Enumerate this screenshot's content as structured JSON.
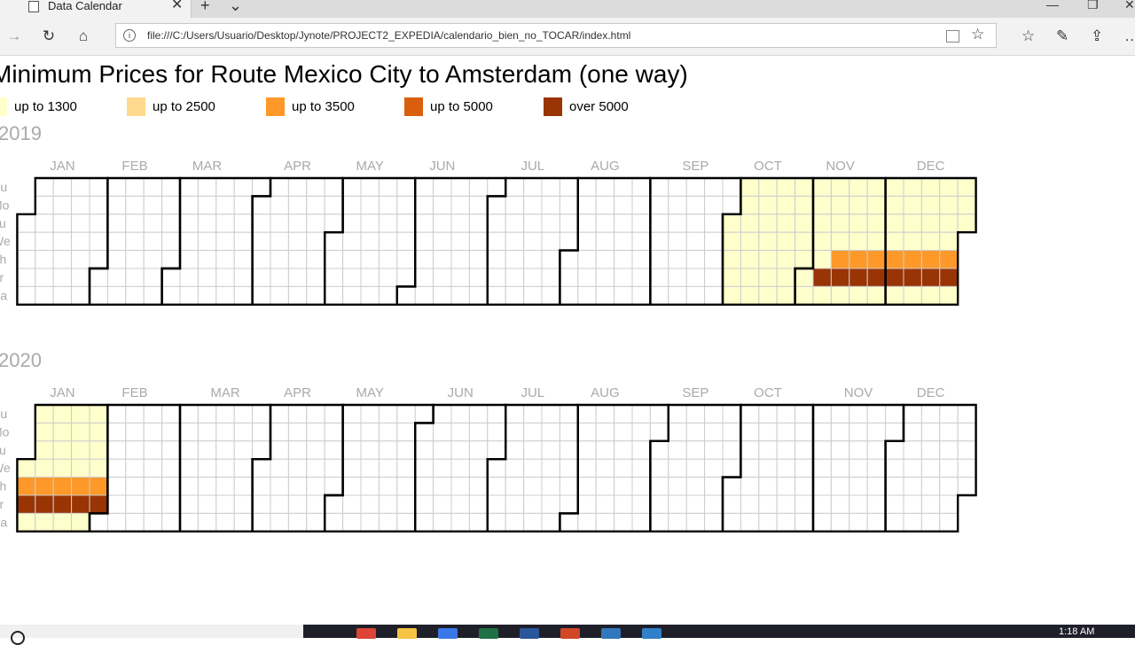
{
  "browser": {
    "tab_title": "Data Calendar",
    "new_tab_glyph": "+",
    "tab_list_glyph": "⌄",
    "address_url": "file:///C:/Users/Usuario/Desktop/Jynote/PROJECT2_EXPEDIA/calendario_bien_no_TOCAR/index.html",
    "icons": [
      "back-arrow-icon",
      "forward-arrow-icon",
      "refresh-icon",
      "home-icon",
      "info-icon",
      "reading-view-icon",
      "favorite-star-icon",
      "favorites-list-icon",
      "pen-icon",
      "share-icon",
      "close-icon",
      "minimize-icon",
      "maximize-icon"
    ]
  },
  "page": {
    "title": "Minimum Prices for Route Mexico City to Amsterdam (one way)"
  },
  "legend": [
    {
      "label": "up to 1300",
      "color": "#ffffcc"
    },
    {
      "label": "up to 2500",
      "color": "#fed98e"
    },
    {
      "label": "up to 3500",
      "color": "#fe9929"
    },
    {
      "label": "up to 5000",
      "color": "#d95f0e"
    },
    {
      "label": "over 5000",
      "color": "#993404"
    }
  ],
  "chart_data": {
    "type": "heatmap",
    "title": "Minimum Prices for Route Mexico City to Amsterdam (one way)",
    "week_starts": "Sunday",
    "day_labels": [
      "Su",
      "Mo",
      "Tu",
      "We",
      "Th",
      "Fr",
      "Sa"
    ],
    "months": [
      "JAN",
      "FEB",
      "MAR",
      "APR",
      "MAY",
      "JUN",
      "JUL",
      "AUG",
      "SEP",
      "OCT",
      "NOV",
      "DEC"
    ],
    "years": [
      {
        "year": "2019",
        "bins_by_weekday": [
          {
            "from": "2019-10-01",
            "to": "2019-12-31",
            "weekdays": [
              "Su",
              "Mo",
              "Tu",
              "We",
              "Sa"
            ],
            "bin": "up to 1300"
          },
          {
            "from": "2019-10-01",
            "to": "2019-11-07",
            "weekdays": [
              "Th"
            ],
            "bin": "up to 1300"
          },
          {
            "from": "2019-10-01",
            "to": "2019-11-01",
            "weekdays": [
              "Fr"
            ],
            "bin": "up to 1300"
          },
          {
            "from": "2019-11-08",
            "to": "2019-12-31",
            "weekdays": [
              "Th"
            ],
            "bin": "up to 3500"
          },
          {
            "from": "2019-11-02",
            "to": "2019-12-31",
            "weekdays": [
              "Fr"
            ],
            "bin": "over 5000"
          }
        ]
      },
      {
        "year": "2020",
        "bins_by_weekday": [
          {
            "from": "2020-01-01",
            "to": "2020-01-31",
            "weekdays": [
              "Su",
              "Mo",
              "Tu",
              "We",
              "Sa"
            ],
            "bin": "up to 1300"
          },
          {
            "from": "2020-01-01",
            "to": "2020-01-31",
            "weekdays": [
              "Th"
            ],
            "bin": "up to 3500"
          },
          {
            "from": "2020-01-01",
            "to": "2020-01-31",
            "weekdays": [
              "Fr"
            ],
            "bin": "over 5000"
          }
        ]
      }
    ]
  },
  "taskbar": {
    "clock": "1:18 AM",
    "apps": [
      {
        "name": "chrome-icon",
        "color": "#db4437"
      },
      {
        "name": "file-explorer-icon",
        "color": "#f6c343"
      },
      {
        "name": "store-icon",
        "color": "#3b78e7"
      },
      {
        "name": "excel-icon",
        "color": "#1e7145"
      },
      {
        "name": "word-icon",
        "color": "#2b579a"
      },
      {
        "name": "powerpoint-icon",
        "color": "#d24726"
      },
      {
        "name": "edge-icon",
        "color": "#3277bc"
      },
      {
        "name": "vscode-icon",
        "color": "#2f80c8"
      }
    ]
  }
}
